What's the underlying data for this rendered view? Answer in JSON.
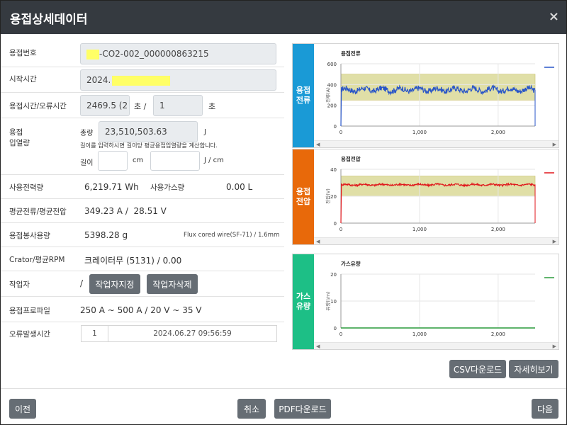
{
  "dialog": {
    "title": "용접상세데이터",
    "close": "×"
  },
  "fields": {
    "weld_no": {
      "label": "용접번호",
      "value": "-CO2-002_000000863215"
    },
    "start_time": {
      "label": "시작시간",
      "value": "2024."
    },
    "weld_time": {
      "label": "용접시간/오류시간",
      "value1": "2469.5 (2",
      "unit1": "초 /",
      "value2": "1",
      "unit2": "초"
    },
    "heat_input": {
      "label_line1": "용접",
      "label_line2": "입열량",
      "total_label": "총량",
      "total_value": "23,510,503.63",
      "total_unit": "J",
      "hint": "길이를 입력하시면 길이당 평균용접입열량을 계산합니다.",
      "length_label": "길이",
      "length_unit": "cm",
      "per_unit": "J / cm",
      "length_value": "",
      "per_value": ""
    },
    "power": {
      "label": "사용전력량",
      "value": "6,219.71 Wh",
      "gas_label": "사용가스량",
      "gas_value": "0.00 L"
    },
    "avg": {
      "label": "평균전류/평균전압",
      "value": "349.23 A /  28.51 V"
    },
    "wire": {
      "label": "용접봉사용량",
      "value": "5398.28 g",
      "spec": "Flux cored wire(SF-71) / 1.6mm"
    },
    "crater": {
      "label": "Crator/평균RPM",
      "value": "크레이터무 (5131) / 0.00"
    },
    "worker": {
      "label": "작업자",
      "slash": "/",
      "assign_btn": "작업자지정",
      "delete_btn": "작업자삭제"
    },
    "profile": {
      "label": "용접프로파일",
      "value": "250 A ~ 500 A / 20 V ~ 35 V"
    },
    "error_time": {
      "label": "오류발생시간",
      "index": "1",
      "time": "2024.06.27 09:56:59"
    }
  },
  "side_labels": {
    "current": {
      "line1": "용접",
      "line2": "전류",
      "color": "#1a9ad6"
    },
    "voltage": {
      "line1": "용접",
      "line2": "전압",
      "color": "#e8690a"
    },
    "gas": {
      "line1": "가스",
      "line2": "유량",
      "color": "#1dbf86"
    }
  },
  "chart_buttons": {
    "csv": "CSV다운로드",
    "detail": "자세히보기"
  },
  "footer": {
    "prev": "이전",
    "cancel": "취소",
    "pdf": "PDF다운로드",
    "next": "다음"
  },
  "chart_data": [
    {
      "type": "line",
      "title": "용접전류",
      "ylabel": "전류(A)",
      "xlim": [
        0,
        2470
      ],
      "ylim": [
        0,
        600
      ],
      "yticks": [
        0,
        200,
        400,
        600
      ],
      "xticks": [
        0,
        1000,
        2000
      ],
      "xtick_labels": [
        "0",
        "1,000",
        "2,000"
      ],
      "band": [
        250,
        500
      ],
      "band_color": "#d6d48a",
      "series": [
        {
          "color": "#2855c8",
          "baseline": 350,
          "noise": 45
        }
      ]
    },
    {
      "type": "line",
      "title": "용접전압",
      "ylabel": "전압(V)",
      "xlim": [
        0,
        2470
      ],
      "ylim": [
        0,
        40
      ],
      "yticks": [
        0,
        20,
        40
      ],
      "xticks": [
        0,
        1000,
        2000
      ],
      "xtick_labels": [
        "0",
        "1,000",
        "2,000"
      ],
      "band": [
        20,
        35
      ],
      "band_color": "#d6d48a",
      "series": [
        {
          "color": "#e0161b",
          "baseline": 28.5,
          "noise": 1.2
        }
      ]
    },
    {
      "type": "line",
      "title": "가스유량",
      "ylabel": "유량(l/m)",
      "xlim": [
        0,
        2470
      ],
      "ylim": [
        0,
        20
      ],
      "yticks": [
        0,
        10,
        20
      ],
      "xticks": [
        0,
        1000,
        2000
      ],
      "xtick_labels": [
        "0",
        "1,000",
        "2,000"
      ],
      "series": [
        {
          "color": "#2a9a3c",
          "baseline": 0,
          "noise": 0
        }
      ]
    }
  ]
}
